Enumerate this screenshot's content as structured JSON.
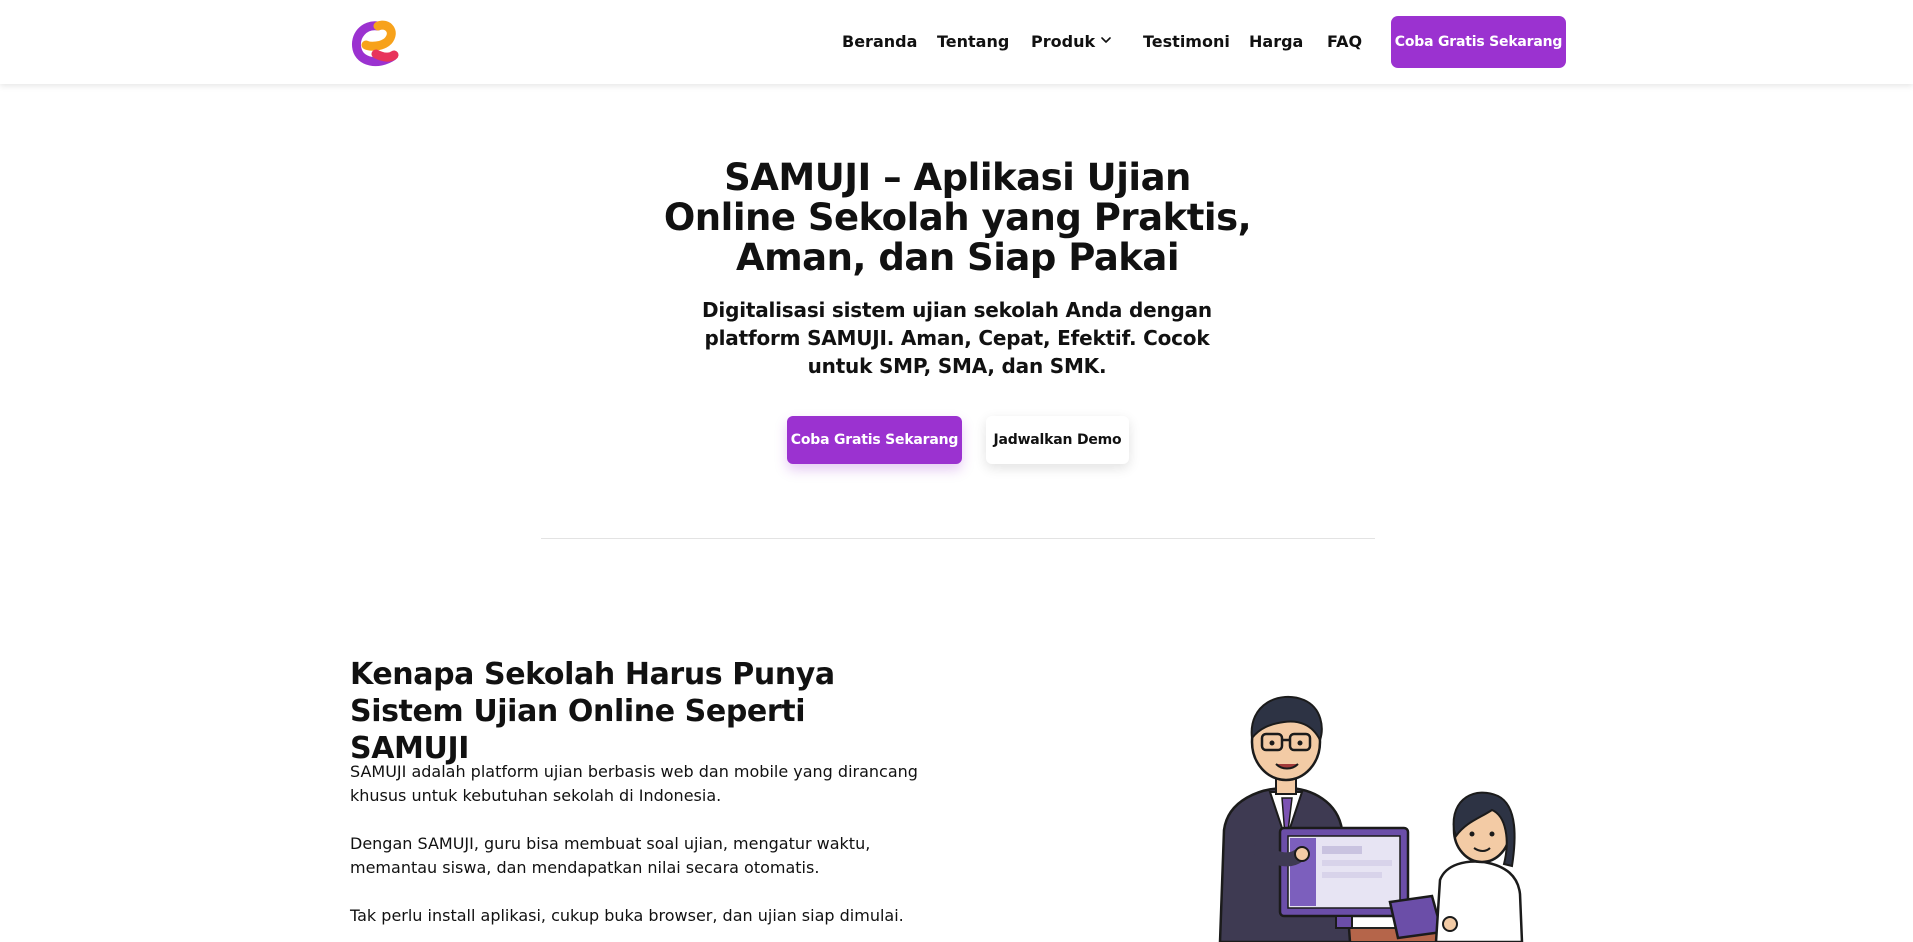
{
  "header": {
    "logo_icon": "brand-logo-icon",
    "nav": [
      {
        "label": "Beranda"
      },
      {
        "label": "Tentang"
      },
      {
        "label": "Produk",
        "icon": "chevron-down-icon"
      },
      {
        "label": "Testimoni"
      },
      {
        "label": "Harga"
      },
      {
        "label": "FAQ"
      }
    ],
    "cta_label": "Coba Gratis Sekarang"
  },
  "hero": {
    "title": "SAMUJI – Aplikasi Ujian Online Sekolah yang Praktis, Aman, dan Siap Pakai",
    "subtitle": "Digitalisasi sistem ujian sekolah Anda dengan platform SAMUJI. Aman, Cepat, Efektif. Cocok untuk SMP, SMA, dan SMK.",
    "primary_button": "Coba Gratis Sekarang",
    "secondary_button": "Jadwalkan Demo"
  },
  "why_section": {
    "title": "Kenapa Sekolah Harus Punya Sistem Ujian Online Seperti SAMUJI",
    "paragraphs": [
      "SAMUJI adalah platform ujian berbasis web dan mobile yang dirancang khusus untuk kebutuhan sekolah di Indonesia.",
      "Dengan SAMUJI, guru bisa membuat soal ujian, mengatur waktu, memantau siswa, dan mendapatkan nilai secara otomatis.",
      "Tak perlu install aplikasi, cukup buka browser, dan ujian siap dimulai."
    ],
    "illustration": "teacher-student-computer-illustration"
  },
  "colors": {
    "accent": "#9b32d0",
    "text": "#111111",
    "background": "#ffffff"
  }
}
